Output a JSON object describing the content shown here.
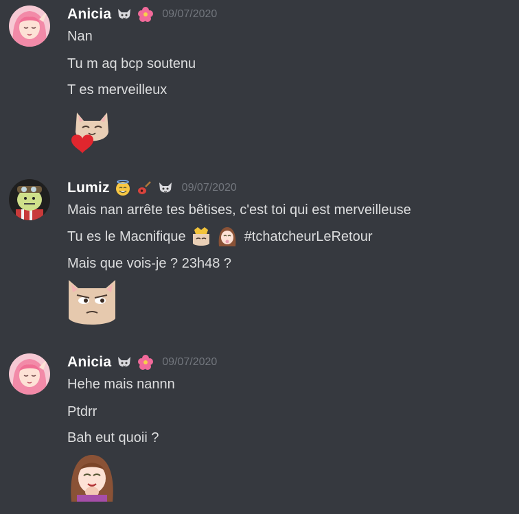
{
  "messages": [
    {
      "author": "Anicia",
      "timestamp": "09/07/2020",
      "badges": [
        "wolf-emoji",
        "hibiscus-emoji"
      ],
      "avatar": "pink-hair-girl-avatar",
      "lines": [
        "Nan",
        "Tu m aq bcp soutenu",
        "T es merveilleux"
      ],
      "sticker": "cat-holding-heart-sticker"
    },
    {
      "author": "Lumiz",
      "timestamp": "09/07/2020",
      "badges": [
        "angel-smile-emoji",
        "guitar-emoji",
        "wolf-emoji"
      ],
      "avatar": "green-face-hat-avatar",
      "lines": [
        "Mais nan arrête tes bêtises, c'est toi qui est merveilleuse",
        "Tu es le Macnifique",
        "#tchatcheurLeRetour",
        "Mais que vois-je ? 23h48 ?"
      ],
      "sticker": "suspicious-cat-sticker"
    },
    {
      "author": "Anicia",
      "timestamp": "09/07/2020",
      "badges": [
        "wolf-emoji",
        "hibiscus-emoji"
      ],
      "avatar": "pink-hair-girl-avatar",
      "lines": [
        "Hehe mais nannn",
        "Ptdrr",
        "Bah eut quoii ?"
      ],
      "sticker": "laughing-girl-sticker"
    }
  ],
  "colors": {
    "background": "#36393f",
    "username": "#ffffff",
    "timestamp": "#72767d",
    "text": "#dcddde"
  }
}
